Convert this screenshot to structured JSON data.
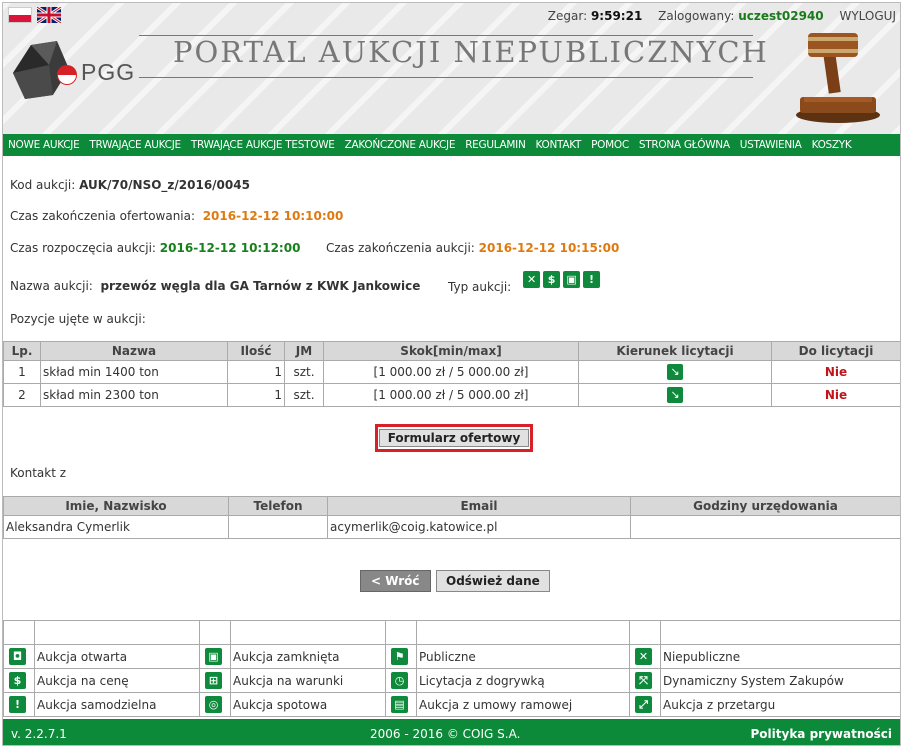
{
  "topbar": {
    "clock_label": "Zegar:",
    "clock_value": "9:59:21",
    "logged_label": "Zalogowany:",
    "user": "uczest02940",
    "logout": "WYLOGUJ"
  },
  "header": {
    "logo_text": "PGG",
    "title": "PORTAL AUKCJI NIEPUBLICZNYCH"
  },
  "nav": [
    "NOWE AUKCJE",
    "TRWAJĄCE AUKCJE",
    "TRWAJĄCE AUKCJE TESTOWE",
    "ZAKOŃCZONE AUKCJE",
    "REGULAMIN",
    "KONTAKT",
    "POMOC",
    "STRONA GŁÓWNA",
    "USTAWIENIA",
    "KOSZYK"
  ],
  "auction": {
    "code_label": "Kod aukcji:",
    "code": "AUK/70/NSO_z/2016/0045",
    "offer_end_label": "Czas zakończenia ofertowania:",
    "offer_end": "2016-12-12 10:10:00",
    "start_label": "Czas rozpoczęcia aukcji:",
    "start": "2016-12-12 10:12:00",
    "end_label": "Czas zakończenia aukcji:",
    "end": "2016-12-12 10:15:00",
    "name_label": "Nazwa aukcji:",
    "name": "przewóz węgla dla GA Tarnów z KWK Jankowice",
    "type_label": "Typ aukcji:",
    "positions_label": "Pozycje ujęte w aukcji:"
  },
  "positions": {
    "headers": [
      "Lp.",
      "Nazwa",
      "Ilość",
      "JM",
      "Skok[min/max]",
      "Kierunek licytacji",
      "Do licytacji"
    ],
    "rows": [
      {
        "lp": "1",
        "name": "skład min 1400 ton",
        "qty": "1",
        "unit": "szt.",
        "step": "[1 000.00 zł / 5 000.00 zł]",
        "bid": "Nie"
      },
      {
        "lp": "2",
        "name": "skład min 2300 ton",
        "qty": "1",
        "unit": "szt.",
        "step": "[1 000.00 zł / 5 000.00 zł]",
        "bid": "Nie"
      }
    ]
  },
  "offer_form_button": "Formularz ofertowy",
  "contact": {
    "label": "Kontakt z",
    "headers": [
      "Imie, Nazwisko",
      "Telefon",
      "Email",
      "Godziny urzędowania"
    ],
    "row": {
      "name": "Aleksandra Cymerlik",
      "phone": "",
      "email": "acymerlik@coig.katowice.pl",
      "hours": ""
    }
  },
  "buttons": {
    "back": "< Wróć",
    "refresh": "Odśwież dane"
  },
  "legend": [
    [
      "Aukcja otwarta",
      "Aukcja zamknięta",
      "Publiczne",
      "Niepubliczne"
    ],
    [
      "Aukcja na cenę",
      "Aukcja na warunki",
      "Licytacja z dogrywką",
      "Dynamiczny System Zakupów"
    ],
    [
      "Aukcja samodzielna",
      "Aukcja spotowa",
      "Aukcja z umowy ramowej",
      "Aukcja z przetargu"
    ]
  ],
  "footer": {
    "version": "v. 2.2.7.1",
    "copyright": "2006 - 2016 © COIG S.A.",
    "privacy": "Polityka prywatności"
  },
  "colors": {
    "brand_green": "#0c8a3a",
    "accent_orange": "#e07a10",
    "date_green": "#16801c",
    "alert_red": "#c0151b"
  }
}
